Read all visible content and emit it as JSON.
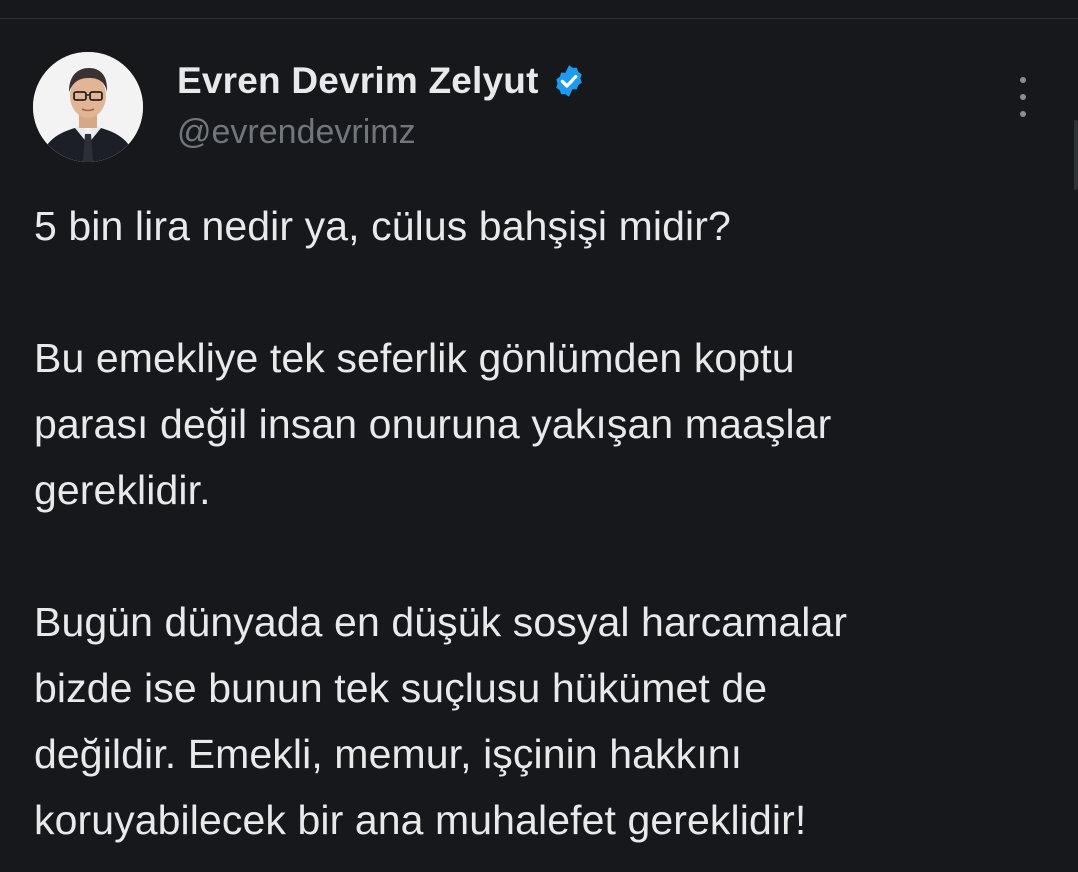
{
  "tweet": {
    "author": {
      "display_name": "Evren Devrim Zelyut",
      "handle": "@evrendevrimz",
      "verified": true,
      "avatar_icon": "profile-photo",
      "verified_icon": "verified-badge-icon"
    },
    "more_icon": "more-options-icon",
    "paragraphs": [
      {
        "lines": [
          "5 bin lira nedir ya, cülus bahşişi midir?"
        ]
      },
      {
        "lines": [
          "Bu emekliye tek seferlik gönlümden koptu",
          "parası değil insan onuruna yakışan maaşlar",
          "gereklidir."
        ]
      },
      {
        "lines": [
          "Bugün dünyada en düşük sosyal harcamalar",
          "bizde ise bunun tek suçlusu hükümet de",
          "değildir. Emekli, memur, işçinin hakkını",
          "koruyabilecek bir ana muhalefet gereklidir!"
        ]
      }
    ]
  },
  "colors": {
    "background": "#16181c",
    "text_primary": "#e7e9ea",
    "text_secondary": "#71767b",
    "verified_blue": "#1d9bf0",
    "divider": "#2f3336"
  }
}
